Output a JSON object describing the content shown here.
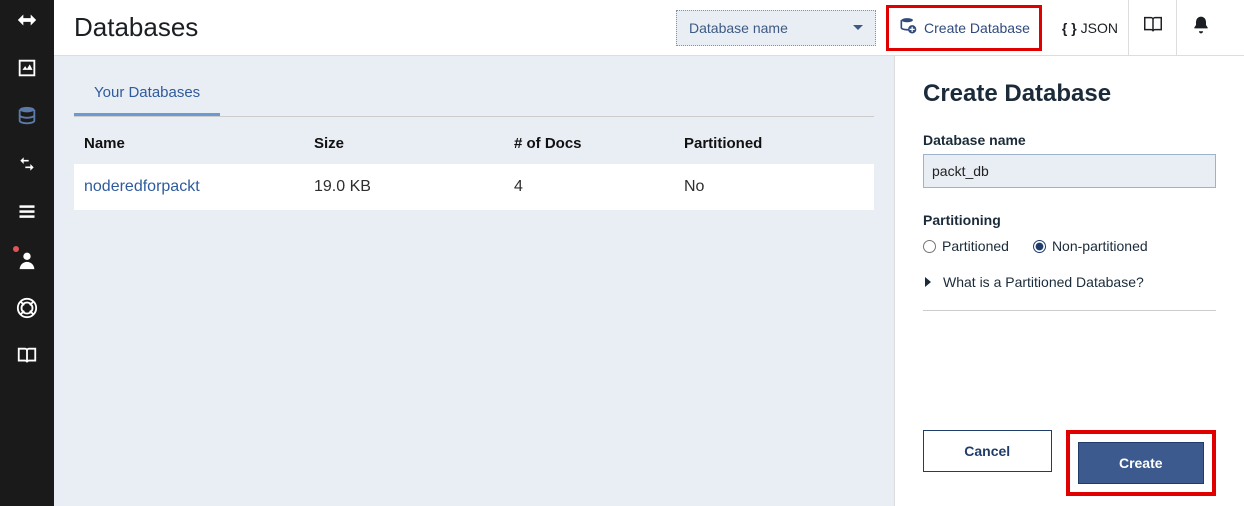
{
  "header": {
    "title": "Databases",
    "db_selector_label": "Database name",
    "create_db_label": "Create Database",
    "json_label": "JSON"
  },
  "listing": {
    "tab_label": "Your Databases",
    "columns": {
      "name": "Name",
      "size": "Size",
      "docs": "# of Docs",
      "partitioned": "Partitioned"
    },
    "rows": [
      {
        "name": "noderedforpackt",
        "size": "19.0 KB",
        "docs": "4",
        "partitioned": "No"
      }
    ]
  },
  "panel": {
    "title": "Create Database",
    "db_name_label": "Database name",
    "db_name_value": "packt_db",
    "partitioning_label": "Partitioning",
    "opt_partitioned": "Partitioned",
    "opt_nonpartitioned": "Non-partitioned",
    "help_link": "What is a Partitioned Database?",
    "cancel_label": "Cancel",
    "create_label": "Create"
  }
}
